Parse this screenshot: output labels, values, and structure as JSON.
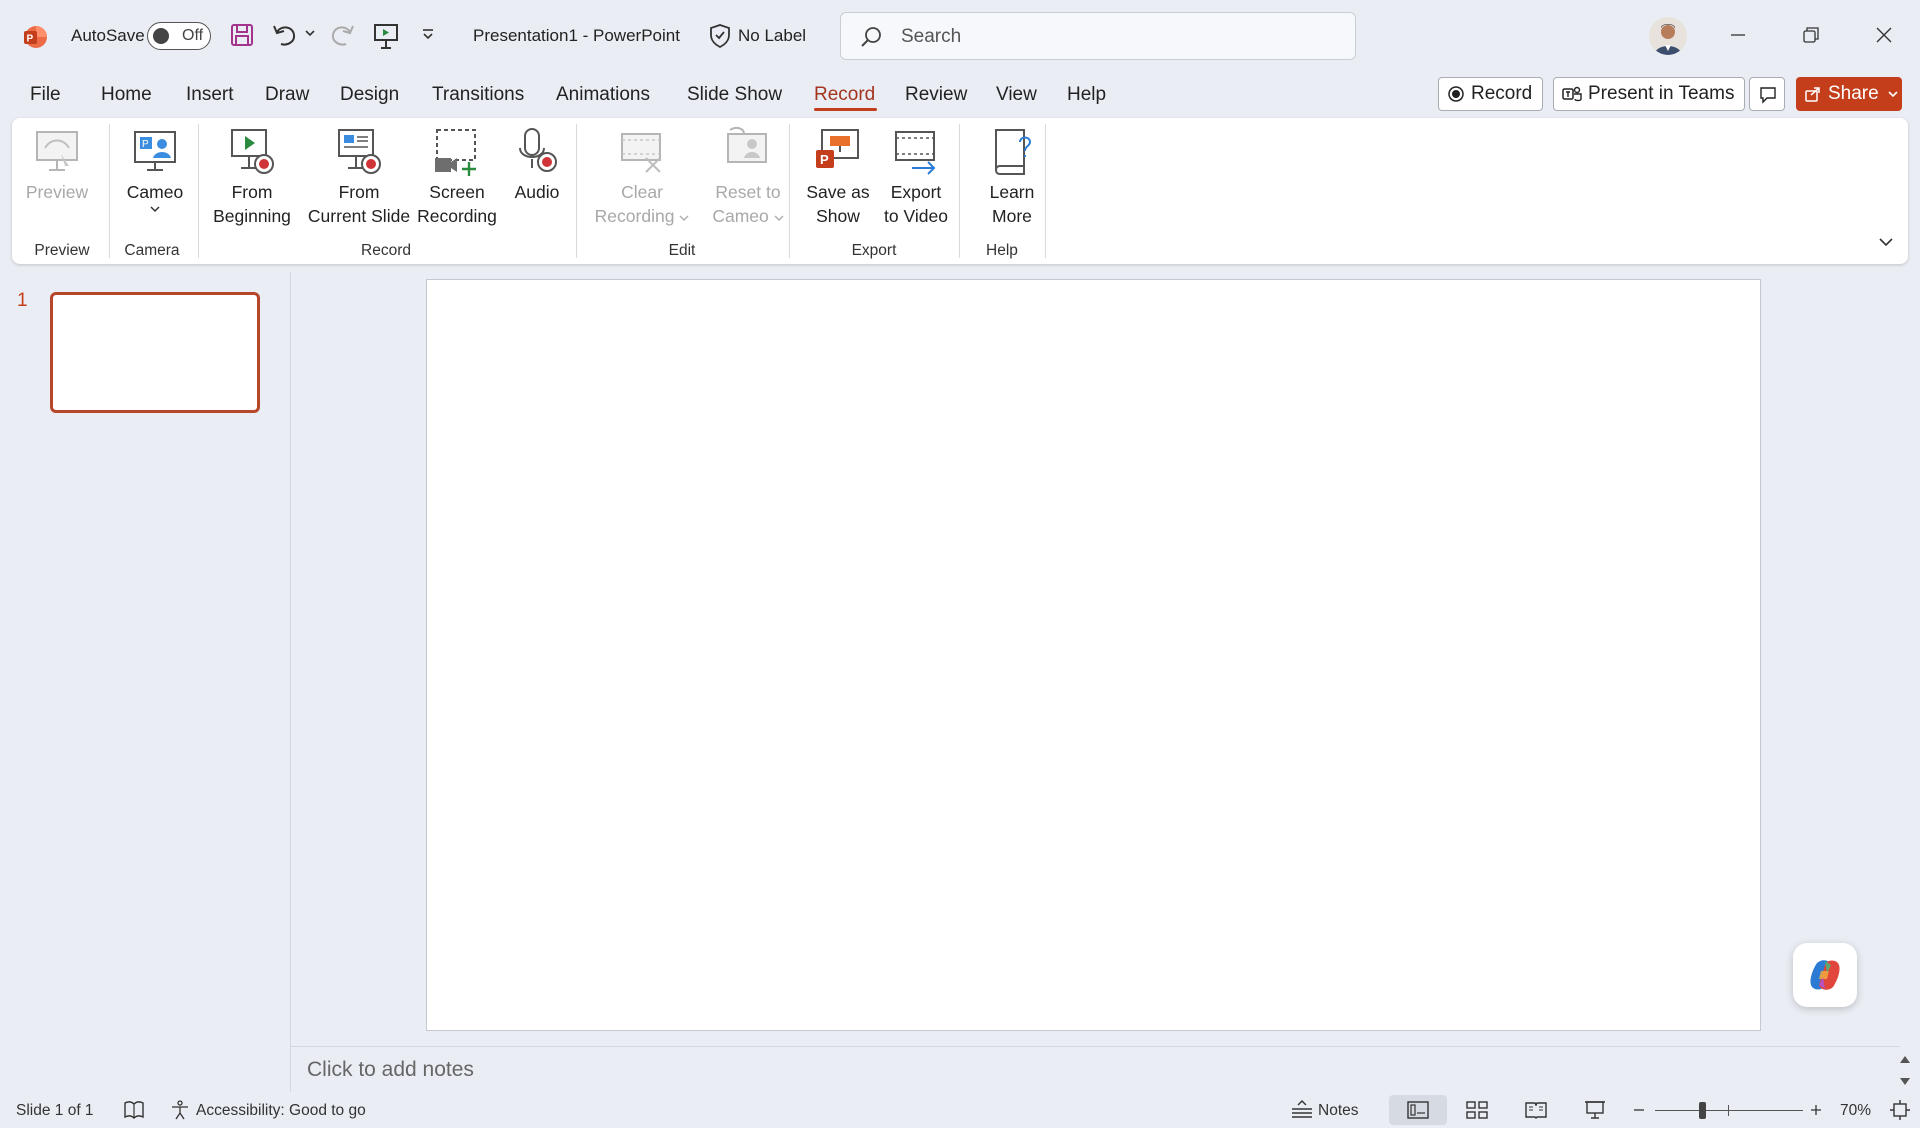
{
  "titlebar": {
    "autosave_label": "AutoSave",
    "autosave_state": "Off",
    "doc_title": "Presentation1  -  PowerPoint",
    "sensitivity_label": "No Label",
    "search_placeholder": "Search"
  },
  "menu": {
    "tabs": [
      {
        "label": "File"
      },
      {
        "label": "Home"
      },
      {
        "label": "Insert"
      },
      {
        "label": "Draw"
      },
      {
        "label": "Design"
      },
      {
        "label": "Transitions"
      },
      {
        "label": "Animations"
      },
      {
        "label": "Slide Show"
      },
      {
        "label": "Record"
      },
      {
        "label": "Review"
      },
      {
        "label": "View"
      },
      {
        "label": "Help"
      }
    ],
    "active_tab": "Record",
    "record_button": "Record",
    "teams_button": "Present in Teams",
    "share_button": "Share"
  },
  "ribbon": {
    "preview": {
      "label": "Preview",
      "group": "Preview"
    },
    "cameo": {
      "label": "Cameo",
      "group": "Camera"
    },
    "from_beginning": {
      "line1": "From",
      "line2": "Beginning"
    },
    "from_current": {
      "line1": "From",
      "line2": "Current Slide"
    },
    "screen_recording": {
      "line1": "Screen",
      "line2": "Recording"
    },
    "audio": {
      "label": "Audio"
    },
    "record_group": "Record",
    "clear_recording": {
      "line1": "Clear",
      "line2": "Recording"
    },
    "reset_to_cameo": {
      "line1": "Reset to",
      "line2": "Cameo"
    },
    "edit_group": "Edit",
    "save_as_show": {
      "line1": "Save as",
      "line2": "Show"
    },
    "export_to_video": {
      "line1": "Export",
      "line2": "to Video"
    },
    "export_group": "Export",
    "learn_more": {
      "line1": "Learn",
      "line2": "More"
    },
    "help_group": "Help"
  },
  "slides_pane": {
    "slide_number": "1"
  },
  "notes": {
    "placeholder": "Click to add notes"
  },
  "status": {
    "slide_info": "Slide 1 of 1",
    "accessibility": "Accessibility: Good to go",
    "notes_label": "Notes",
    "zoom": "70%"
  },
  "colors": {
    "accent": "#c43e1c",
    "background": "#eaeef4",
    "ribbon": "#ffffff"
  }
}
